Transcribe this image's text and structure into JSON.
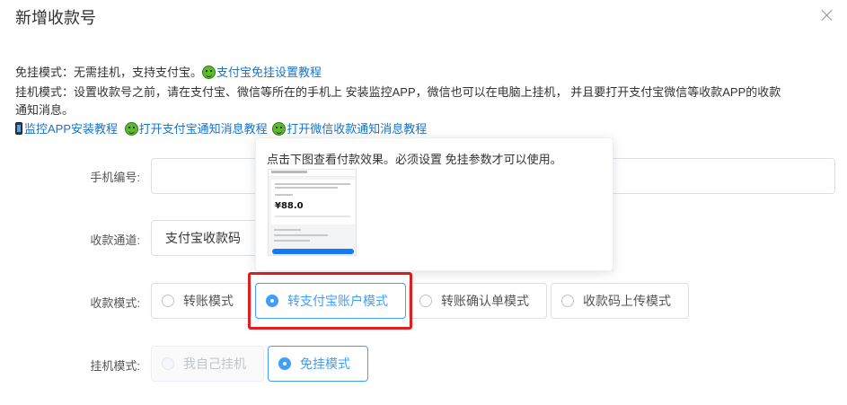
{
  "dialog": {
    "title": "新增收款号"
  },
  "info": {
    "line1_text": "免挂模式：无需挂机，支持支付宝。",
    "line1_link": "支付宝免挂设置教程",
    "line2_text": "挂机模式：设置收款号之前，请在支付宝、微信等所在的手机上 安装监控APP，微信也可以在电脑上挂机， 并且要打开支付宝微信等收款APP的收款",
    "line3_text": "通知消息。",
    "links": [
      "监控APP安装教程",
      "打开支付宝通知消息教程",
      "打开微信收款通知消息教程"
    ]
  },
  "form": {
    "phone_label": "手机编号:",
    "phone_value": "",
    "channel_label": "收款通道:",
    "channel_value": "支付宝收款码",
    "mode_label": "收款模式:",
    "mode_options": [
      "转账模式",
      "转支付宝账户模式",
      "转账确认单模式",
      "收款码上传模式"
    ],
    "mode_selected": "转支付宝账户模式",
    "hang_label": "挂机模式:",
    "hang_options": [
      "我自己挂机",
      "免挂模式"
    ],
    "hang_selected": "免挂模式"
  },
  "popover": {
    "text": "点击下图查看付款效果。必须设置 免挂参数才可以使用。",
    "preview_amount": "¥88.0"
  },
  "colors": {
    "accent": "#409eff",
    "link": "#1a73c8",
    "highlight": "#e02020"
  }
}
